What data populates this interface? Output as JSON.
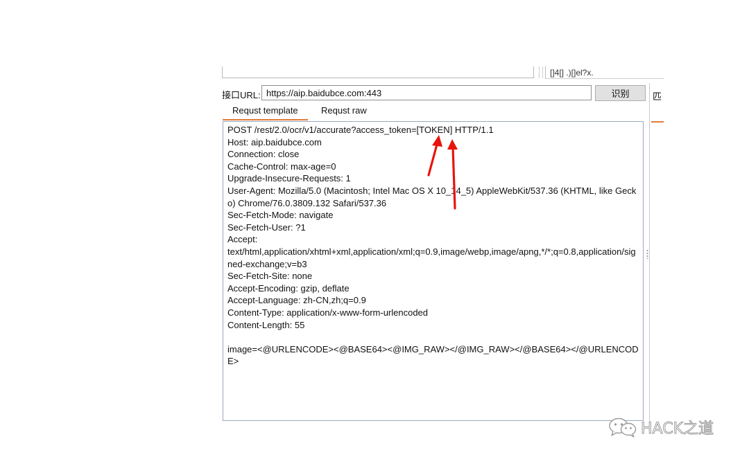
{
  "top_panel": {
    "right_text": "[]4[] .)[]el?x."
  },
  "url_row": {
    "label": "接口URL:",
    "value": "https://aip.baidubce.com:443",
    "ocr_button": "识别"
  },
  "right_panel": {
    "tab_label": "匹"
  },
  "tabs": [
    {
      "label": "Requst template",
      "active": true
    },
    {
      "label": "Requst raw",
      "active": false
    }
  ],
  "request_text": "POST /rest/2.0/ocr/v1/accurate?access_token=[TOKEN] HTTP/1.1\nHost: aip.baidubce.com\nConnection: close\nCache-Control: max-age=0\nUpgrade-Insecure-Requests: 1\nUser-Agent: Mozilla/5.0 (Macintosh; Intel Mac OS X 10_14_5) AppleWebKit/537.36 (KHTML, like Gecko) Chrome/76.0.3809.132 Safari/537.36\nSec-Fetch-Mode: navigate\nSec-Fetch-User: ?1\nAccept:\ntext/html,application/xhtml+xml,application/xml;q=0.9,image/webp,image/apng,*/*;q=0.8,application/signed-exchange;v=b3\nSec-Fetch-Site: none\nAccept-Encoding: gzip, deflate\nAccept-Language: zh-CN,zh;q=0.9\nContent-Type: application/x-www-form-urlencoded\nContent-Length: 55\n\nimage=<@URLENCODE><@BASE64><@IMG_RAW></@IMG_RAW></@BASE64></@URLENCODE>",
  "annotations": {
    "arrow_color": "#e8140c"
  },
  "watermark": {
    "text": "HACK之道",
    "logo": "wechat-logo"
  },
  "colors": {
    "tab_accent": "#e07b3d",
    "editor_border": "#9aa8bf"
  }
}
